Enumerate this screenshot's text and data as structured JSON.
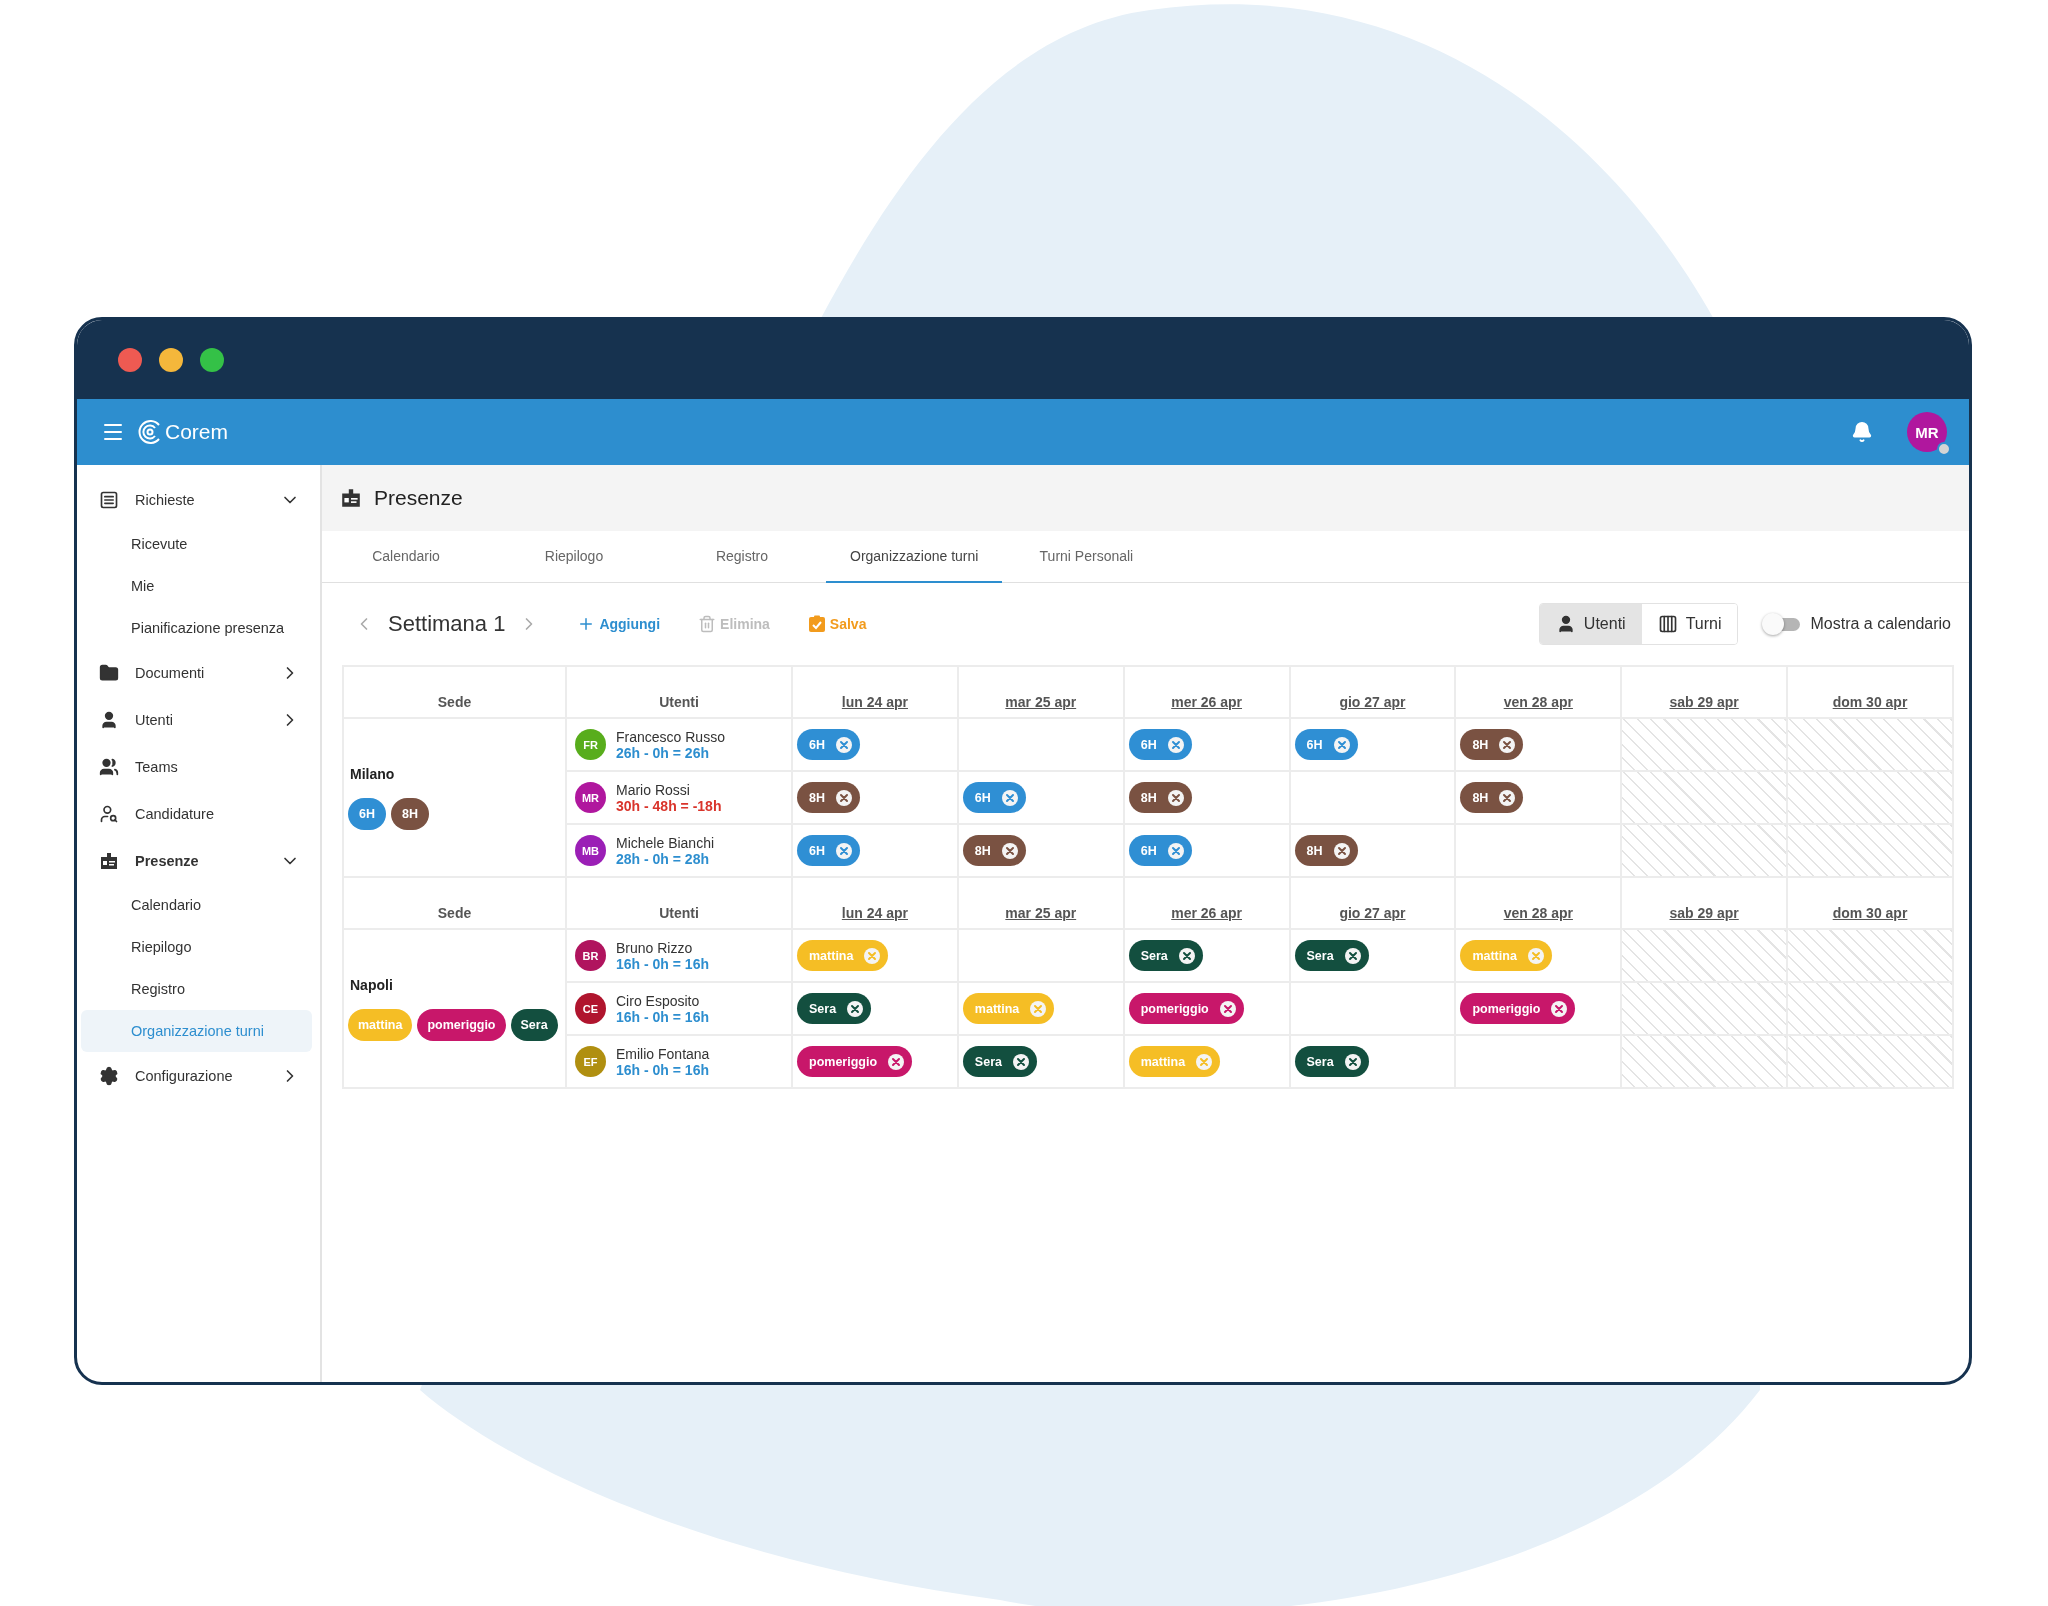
{
  "window": {
    "app_bar": {
      "logo": "Corem",
      "avatar": {
        "initials": "MR",
        "color": "#b0179e"
      }
    },
    "sidebar": {
      "items": [
        {
          "label": "Richieste",
          "kind": "group",
          "expanded": true,
          "selected": false,
          "children": [
            {
              "label": "Ricevute",
              "selected": false
            },
            {
              "label": "Mie",
              "selected": false
            },
            {
              "label": "Pianificazione presenza",
              "selected": false
            }
          ]
        },
        {
          "label": "Documenti",
          "kind": "group",
          "expanded": false,
          "selected": false
        },
        {
          "label": "Utenti",
          "kind": "group",
          "expanded": false,
          "selected": false
        },
        {
          "label": "Teams",
          "kind": "link",
          "selected": false
        },
        {
          "label": "Candidature",
          "kind": "link",
          "selected": false
        },
        {
          "label": "Presenze",
          "kind": "group",
          "expanded": true,
          "selected": true,
          "children": [
            {
              "label": "Calendario",
              "selected": false
            },
            {
              "label": "Riepilogo",
              "selected": false
            },
            {
              "label": "Registro",
              "selected": false
            },
            {
              "label": "Organizzazione turni",
              "selected": true
            }
          ]
        },
        {
          "label": "Configurazione",
          "kind": "group",
          "expanded": false,
          "selected": false
        }
      ]
    },
    "page": {
      "title": "Presenze",
      "tabs": [
        {
          "label": "Calendario",
          "selected": false
        },
        {
          "label": "Riepilogo",
          "selected": false
        },
        {
          "label": "Registro",
          "selected": false
        },
        {
          "label": "Organizzazione turni",
          "selected": true
        },
        {
          "label": "Turni Personali",
          "selected": false
        }
      ],
      "toolbar": {
        "week": "Settimana 1",
        "actions": [
          {
            "label": "Aggiungi",
            "kind": "add",
            "disabled": false
          },
          {
            "label": "Elimina",
            "kind": "delete",
            "disabled": true
          },
          {
            "label": "Salva",
            "kind": "save",
            "disabled": false
          }
        ],
        "view_toggle": [
          {
            "label": "Utenti",
            "selected": true
          },
          {
            "label": "Turni",
            "selected": false
          }
        ],
        "switch": {
          "label": "Mostra a calendario",
          "on": false
        }
      },
      "groups": [
        {
          "headers": {
            "site": "Sede",
            "users": "Utenti"
          },
          "days": [
            {
              "label": "lun 24 apr",
              "disabled": false
            },
            {
              "label": "mar 25 apr",
              "disabled": false
            },
            {
              "label": "mer 26 apr",
              "disabled": false
            },
            {
              "label": "gio 27 apr",
              "disabled": false
            },
            {
              "label": "ven 28 apr",
              "disabled": false
            },
            {
              "label": "sab 29 apr",
              "disabled": true
            },
            {
              "label": "dom 30 apr",
              "disabled": true
            }
          ],
          "site": "Milano",
          "shift_types": [
            {
              "label": "6H",
              "color": "#2f8fd4"
            },
            {
              "label": "8H",
              "color": "#7a5242"
            }
          ],
          "users": [
            {
              "initials": "FR",
              "color": "#58ad1c",
              "name": "Francesco Russo",
              "hours": "26h - 0h = 26h",
              "negative": false,
              "shifts": [
                {
                  "kind": "shift",
                  "label": "6H",
                  "color": "#2f8fd4"
                },
                {
                  "kind": "empty"
                },
                {
                  "kind": "shift",
                  "label": "6H",
                  "color": "#2f8fd4"
                },
                {
                  "kind": "shift",
                  "label": "6H",
                  "color": "#2f8fd4"
                },
                {
                  "kind": "shift",
                  "label": "8H",
                  "color": "#7a5242"
                },
                {
                  "kind": "empty"
                },
                {
                  "kind": "empty"
                }
              ]
            },
            {
              "initials": "MR",
              "color": "#b0179e",
              "name": "Mario Rossi",
              "hours": "30h - 48h = -18h",
              "negative": true,
              "shifts": [
                {
                  "kind": "shift",
                  "label": "8H",
                  "color": "#7a5242"
                },
                {
                  "kind": "shift",
                  "label": "6H",
                  "color": "#2f8fd4"
                },
                {
                  "kind": "shift",
                  "label": "8H",
                  "color": "#7a5242"
                },
                {
                  "kind": "empty"
                },
                {
                  "kind": "shift",
                  "label": "8H",
                  "color": "#7a5242"
                },
                {
                  "kind": "empty"
                },
                {
                  "kind": "empty"
                }
              ]
            },
            {
              "initials": "MB",
              "color": "#9b1fb6",
              "name": "Michele Bianchi",
              "hours": "28h - 0h = 28h",
              "negative": false,
              "shifts": [
                {
                  "kind": "shift",
                  "label": "6H",
                  "color": "#2f8fd4"
                },
                {
                  "kind": "shift",
                  "label": "8H",
                  "color": "#7a5242"
                },
                {
                  "kind": "shift",
                  "label": "6H",
                  "color": "#2f8fd4"
                },
                {
                  "kind": "shift",
                  "label": "8H",
                  "color": "#7a5242"
                },
                {
                  "kind": "empty"
                },
                {
                  "kind": "empty"
                },
                {
                  "kind": "empty"
                }
              ]
            }
          ]
        },
        {
          "headers": {
            "site": "Sede",
            "users": "Utenti"
          },
          "days": [
            {
              "label": "lun 24 apr",
              "disabled": false
            },
            {
              "label": "mar 25 apr",
              "disabled": false
            },
            {
              "label": "mer 26 apr",
              "disabled": false
            },
            {
              "label": "gio 27 apr",
              "disabled": false
            },
            {
              "label": "ven 28 apr",
              "disabled": false
            },
            {
              "label": "sab 29 apr",
              "disabled": true
            },
            {
              "label": "dom 30 apr",
              "disabled": true
            }
          ],
          "site": "Napoli",
          "shift_types": [
            {
              "label": "mattina",
              "color": "#f5be25"
            },
            {
              "label": "pomeriggio",
              "color": "#c8176a"
            },
            {
              "label": "Sera",
              "color": "#134f3f"
            }
          ],
          "users": [
            {
              "initials": "BR",
              "color": "#b0145e",
              "name": "Bruno Rizzo",
              "hours": "16h - 0h = 16h",
              "negative": false,
              "shifts": [
                {
                  "kind": "shift",
                  "label": "mattina",
                  "color": "#f5be25"
                },
                {
                  "kind": "empty"
                },
                {
                  "kind": "shift",
                  "label": "Sera",
                  "color": "#134f3f"
                },
                {
                  "kind": "shift",
                  "label": "Sera",
                  "color": "#134f3f"
                },
                {
                  "kind": "shift",
                  "label": "mattina",
                  "color": "#f5be25"
                },
                {
                  "kind": "empty"
                },
                {
                  "kind": "empty"
                }
              ]
            },
            {
              "initials": "CE",
              "color": "#b0152e",
              "name": "Ciro Esposito",
              "hours": "16h - 0h = 16h",
              "negative": false,
              "shifts": [
                {
                  "kind": "shift",
                  "label": "Sera",
                  "color": "#134f3f"
                },
                {
                  "kind": "shift",
                  "label": "mattina",
                  "color": "#f5be25"
                },
                {
                  "kind": "shift",
                  "label": "pomeriggio",
                  "color": "#c8176a"
                },
                {
                  "kind": "empty"
                },
                {
                  "kind": "shift",
                  "label": "pomeriggio",
                  "color": "#c8176a"
                },
                {
                  "kind": "empty"
                },
                {
                  "kind": "empty"
                }
              ]
            },
            {
              "initials": "EF",
              "color": "#b08f10",
              "name": "Emilio Fontana",
              "hours": "16h - 0h = 16h",
              "negative": false,
              "shifts": [
                {
                  "kind": "shift",
                  "label": "pomeriggio",
                  "color": "#c8176a"
                },
                {
                  "kind": "shift",
                  "label": "Sera",
                  "color": "#134f3f"
                },
                {
                  "kind": "shift",
                  "label": "mattina",
                  "color": "#f5be25"
                },
                {
                  "kind": "shift",
                  "label": "Sera",
                  "color": "#134f3f"
                },
                {
                  "kind": "empty"
                },
                {
                  "kind": "empty"
                },
                {
                  "kind": "empty"
                }
              ]
            }
          ]
        }
      ]
    }
  }
}
